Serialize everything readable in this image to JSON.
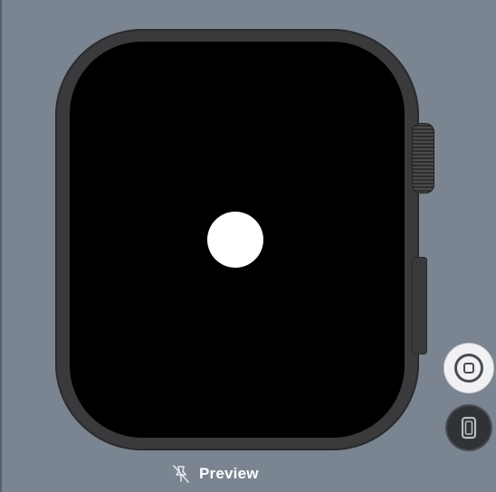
{
  "preview": {
    "label": "Preview",
    "icon": "pin-slash-icon"
  },
  "controls": {
    "home_icon": "home-button-icon",
    "device_icon": "device-rotate-icon"
  },
  "colors": {
    "background": "#7b8591",
    "watch_case": "#3a3a3c",
    "screen": "#000000",
    "dot": "#ffffff"
  }
}
